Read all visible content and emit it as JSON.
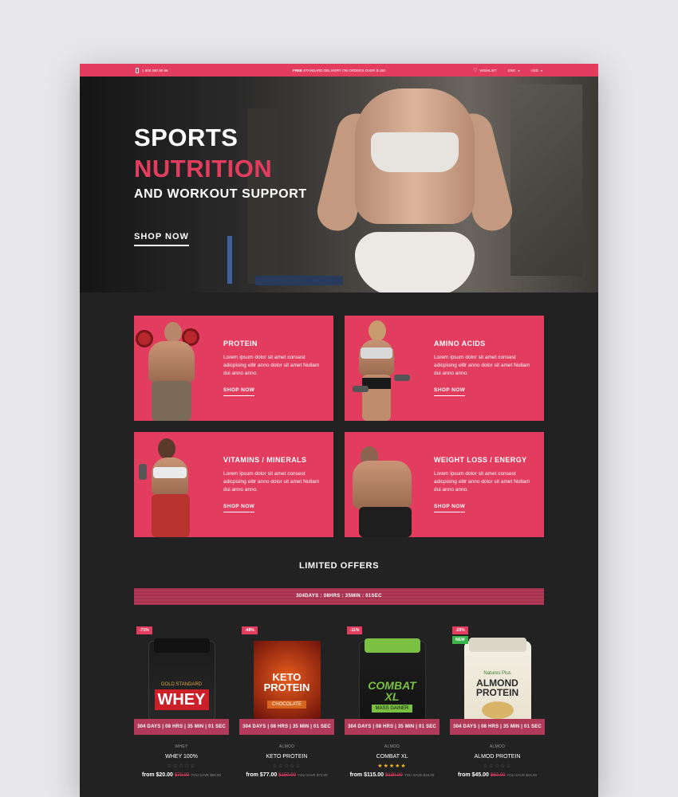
{
  "topbar": {
    "phone": "1 800 280 90 66",
    "promo_bold": "FREE",
    "promo_text": "STANDARD DELIVERY ON ORDERS OVER $ 150",
    "wishlist": "WISHLIST",
    "language": "ENG",
    "currency": "USD"
  },
  "hero": {
    "line1": "SPORTS",
    "line2": "NUTRITION",
    "line3": "AND WORKOUT SUPPORT",
    "cta": "SHOP NOW"
  },
  "categories": [
    {
      "title": "PROTEIN",
      "desc": "Lorem ipsum dolor sit amet consest adicpising elitr anno dolor sit amet Nullam dui anno anno.",
      "link": "SHOP NOW"
    },
    {
      "title": "AMINO ACIDS",
      "desc": "Lorem ipsum dolor sit amet consest adicpising elitr anno dolor sit amet Nullam dui anno anno.",
      "link": "SHOP NOW"
    },
    {
      "title": "VITAMINS / MINERALS",
      "desc": "Lorem ipsum dolor sit amet consest adicpising elitr anno dolor sit amet Nullam dui anno anno.",
      "link": "SHOP NOW"
    },
    {
      "title": "WEIGHT LOSS / ENERGY",
      "desc": "Lorem ipsum dolor sit amet consest adicpising elitr anno dolor sit amet Nullam dui anno anno.",
      "link": "SHOP NOW"
    }
  ],
  "offers": {
    "title": "LIMITED OFFERS",
    "countdown": "304DAYS : 08HRS : 35MIN : 01SEC"
  },
  "products": [
    {
      "discount": "-71%",
      "is_new": false,
      "brand_label": "WHEY",
      "brand_sub": "GOLD STANDARD",
      "timer": "304 DAYS | 08 HRS | 35 MIN | 01 SEC",
      "category": "WHEY",
      "name": "WHEY 100%",
      "stars": "☆☆☆☆☆",
      "from": "from $20.00",
      "old": "$70.00",
      "save": "YOU SAVE $50.00"
    },
    {
      "discount": "-48%",
      "is_new": false,
      "brand_label": "KETO PROTEIN",
      "brand_sub": "CHOCOLATE",
      "timer": "304 DAYS | 08 HRS | 35 MIN | 01 SEC",
      "category": "ALMOD",
      "name": "KETO PROTEIN",
      "stars": "☆☆☆☆☆",
      "from": "from $77.00",
      "old": "$150.00",
      "save": "YOU SAVE $73.00"
    },
    {
      "discount": "-11%",
      "is_new": false,
      "brand_label": "COMBAT XL",
      "brand_sub": "MASS GAINER",
      "timer": "304 DAYS | 08 HRS | 35 MIN | 01 SEC",
      "category": "ALMOD",
      "name": "COMBAT XL",
      "stars": "★★★★★",
      "from": "from $115.00",
      "old": "$130.00",
      "save": "YOU SAVE $15.00"
    },
    {
      "discount": "-25%",
      "is_new": true,
      "new_label": "NEW",
      "brand_label": "ALMOND PROTEIN",
      "brand_sub": "Natures Plus",
      "timer": "304 DAYS | 08 HRS | 35 MIN | 01 SEC",
      "category": "ALMOD",
      "name": "ALMOD PROTEIN",
      "stars": "☆☆☆☆☆",
      "from": "from $45.00",
      "old": "$60.00",
      "save": "YOU SAVE $15.00"
    }
  ],
  "colors": {
    "accent": "#e23d5f",
    "background": "#222222",
    "timer": "#b13a58"
  }
}
